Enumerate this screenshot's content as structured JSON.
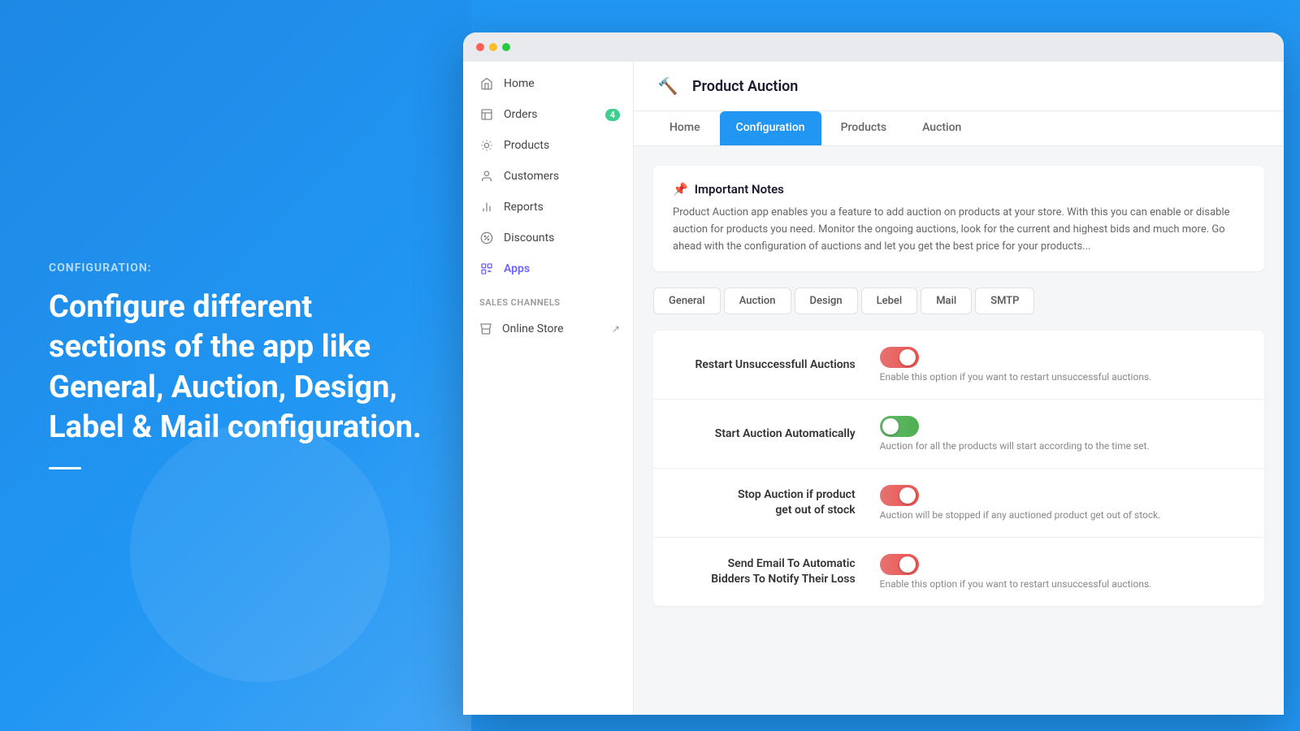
{
  "left": {
    "label": "CONFIGURATION:",
    "title": "Configure different sections of the app like General, Auction, Design, Label & Mail configuration."
  },
  "browser": {
    "dots": [
      "red",
      "yellow",
      "green"
    ]
  },
  "sidebar": {
    "nav_items": [
      {
        "id": "home",
        "label": "Home",
        "icon": "home"
      },
      {
        "id": "orders",
        "label": "Orders",
        "icon": "orders",
        "badge": "4"
      },
      {
        "id": "products",
        "label": "Products",
        "icon": "products"
      },
      {
        "id": "customers",
        "label": "Customers",
        "icon": "customers"
      },
      {
        "id": "reports",
        "label": "Reports",
        "icon": "reports"
      },
      {
        "id": "discounts",
        "label": "Discounts",
        "icon": "discounts"
      },
      {
        "id": "apps",
        "label": "Apps",
        "icon": "apps",
        "active": true
      }
    ],
    "section_label": "SALES CHANNELS",
    "channels": [
      {
        "id": "online-store",
        "label": "Online Store",
        "icon": "store",
        "external": true
      }
    ]
  },
  "header": {
    "app_title": "Product Auction"
  },
  "tabs": {
    "items": [
      "Home",
      "Configuration",
      "Products",
      "Auction"
    ],
    "active": "Configuration"
  },
  "notes": {
    "title": "Important Notes",
    "icon": "📌",
    "text": "Product Auction app enables you a feature to add auction on products at your store. With this you can enable or disable auction for products you need. Monitor the ongoing auctions, look for the current and highest bids and much more. Go ahead with the configuration of auctions and let you get the best price for your products..."
  },
  "config_tabs": {
    "items": [
      "General",
      "Auction",
      "Design",
      "Lebel",
      "Mail",
      "SMTP"
    ],
    "active": "Auction"
  },
  "settings": [
    {
      "label": "Restart Unsuccessfull Auctions",
      "toggle": "off",
      "desc": "Enable this option if you want to restart unsuccessful auctions."
    },
    {
      "label": "Start Auction Automatically",
      "toggle": "on",
      "desc": "Auction for all the products will start according to the time set."
    },
    {
      "label": "Stop Auction if product\nget out of stock",
      "toggle": "off",
      "desc": "Auction will be stopped if any auctioned product get out of stock."
    },
    {
      "label": "Send Email To Automatic\nBidders To Notify Their Loss",
      "toggle": "off",
      "desc": "Enable this option if you want to restart unsuccessful auctions."
    }
  ]
}
